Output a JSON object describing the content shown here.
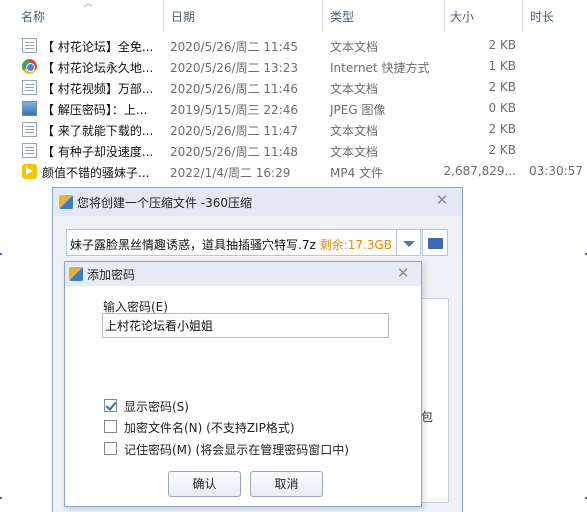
{
  "explorer": {
    "columns": {
      "name": "名称",
      "date": "日期",
      "type": "类型",
      "size": "大小",
      "duration": "时长"
    },
    "files": [
      {
        "icon": "text-file-icon",
        "name": "【 村花论坛】全免...",
        "date": "2020/5/26/周二 11:45",
        "type": "文本文档",
        "size": "2 KB",
        "duration": ""
      },
      {
        "icon": "internet-shortcut-icon",
        "name": "【 村花论坛永久地...",
        "date": "2020/5/26/周二 13:23",
        "type": "Internet 快捷方式",
        "size": "1 KB",
        "duration": ""
      },
      {
        "icon": "text-file-icon",
        "name": "【 村花视频】万部...",
        "date": "2020/5/26/周二 11:46",
        "type": "文本文档",
        "size": "2 KB",
        "duration": ""
      },
      {
        "icon": "image-file-icon",
        "name": "【 解压密码】：上...",
        "date": "2019/5/15/周三 22:46",
        "type": "JPEG 图像",
        "size": "0 KB",
        "duration": ""
      },
      {
        "icon": "text-file-icon",
        "name": "【 来了就能下载的...",
        "date": "2020/5/26/周二 11:47",
        "type": "文本文档",
        "size": "2 KB",
        "duration": ""
      },
      {
        "icon": "text-file-icon",
        "name": "【 有种子却没速度...",
        "date": "2020/5/26/周二 11:48",
        "type": "文本文档",
        "size": "2 KB",
        "duration": ""
      },
      {
        "icon": "video-file-icon",
        "name": "颜值不错的骚妹子...",
        "date": "2022/1/4/周二 16:29",
        "type": "MP4 文件",
        "size": "2,687,829...",
        "duration": "03:30:57"
      }
    ]
  },
  "compress_dialog": {
    "title": "您将创建一个压缩文件 -360压缩",
    "filename": "妹子露脸黑丝情趣诱惑，道具抽插骚穴特写.7z",
    "remaining": "剩余:17.3GB",
    "partial_text": "包",
    "close": "✕"
  },
  "password_dialog": {
    "title": "添加密码",
    "close": "✕",
    "input_label": "输入密码(E)",
    "input_value": "上村花论坛看小姐姐",
    "options": [
      {
        "label": "显示密码(S)",
        "checked": true
      },
      {
        "label": "加密文件名(N) (不支持ZIP格式)",
        "checked": false
      },
      {
        "label": "记住密码(M) (将会显示在管理密码窗口中)",
        "checked": false
      }
    ],
    "ok_label": "确认",
    "cancel_label": "取消"
  }
}
